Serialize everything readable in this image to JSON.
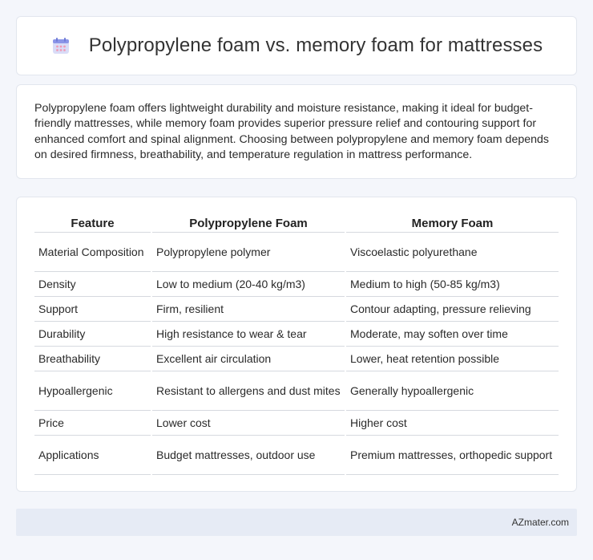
{
  "header": {
    "title": "Polypropylene foam vs. memory foam for mattresses",
    "icon": "calendar-icon",
    "icon_colors": {
      "top": "#8b95e8",
      "body": "#d9dcf7",
      "dots": "#f09ab6"
    }
  },
  "intro": {
    "text": "Polypropylene foam offers lightweight durability and moisture resistance, making it ideal for budget-friendly mattresses, while memory foam provides superior pressure relief and contouring support for enhanced comfort and spinal alignment. Choosing between polypropylene and memory foam depends on desired firmness, breathability, and temperature regulation in mattress performance."
  },
  "table": {
    "headers": [
      "Feature",
      "Polypropylene Foam",
      "Memory Foam"
    ],
    "rows": [
      [
        "Material Composition",
        "Polypropylene polymer",
        "Viscoelastic polyurethane"
      ],
      [
        "Density",
        "Low to medium (20-40 kg/m3)",
        "Medium to high (50-85 kg/m3)"
      ],
      [
        "Support",
        "Firm, resilient",
        "Contour adapting, pressure relieving"
      ],
      [
        "Durability",
        "High resistance to wear & tear",
        "Moderate, may soften over time"
      ],
      [
        "Breathability",
        "Excellent air circulation",
        "Lower, heat retention possible"
      ],
      [
        "Hypoallergenic",
        "Resistant to allergens and dust mites",
        "Generally hypoallergenic"
      ],
      [
        "Price",
        "Lower cost",
        "Higher cost"
      ],
      [
        "Applications",
        "Budget mattresses, outdoor use",
        "Premium mattresses, orthopedic support"
      ]
    ]
  },
  "footer": {
    "brand": "AZmater.com"
  }
}
